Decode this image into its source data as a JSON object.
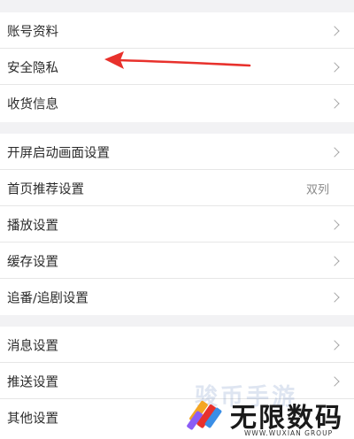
{
  "groups": [
    {
      "items": [
        {
          "label": "账号资料"
        },
        {
          "label": "安全隐私"
        },
        {
          "label": "收货信息"
        }
      ]
    },
    {
      "items": [
        {
          "label": "开屏启动画面设置"
        },
        {
          "label": "首页推荐设置",
          "value": "双列"
        },
        {
          "label": "播放设置"
        },
        {
          "label": "缓存设置"
        },
        {
          "label": "追番/追剧设置"
        }
      ]
    },
    {
      "items": [
        {
          "label": "消息设置"
        },
        {
          "label": "推送设置"
        },
        {
          "label": "其他设置"
        }
      ]
    }
  ],
  "watermark": {
    "faint_text": "骏币手游",
    "brand_text": "无限数码",
    "brand_sub": "WWW.WUXIAN GROUP"
  },
  "colors": {
    "background": "#f2f2f4",
    "arrow": "#e8312c",
    "chevron": "#a5a5a5"
  }
}
